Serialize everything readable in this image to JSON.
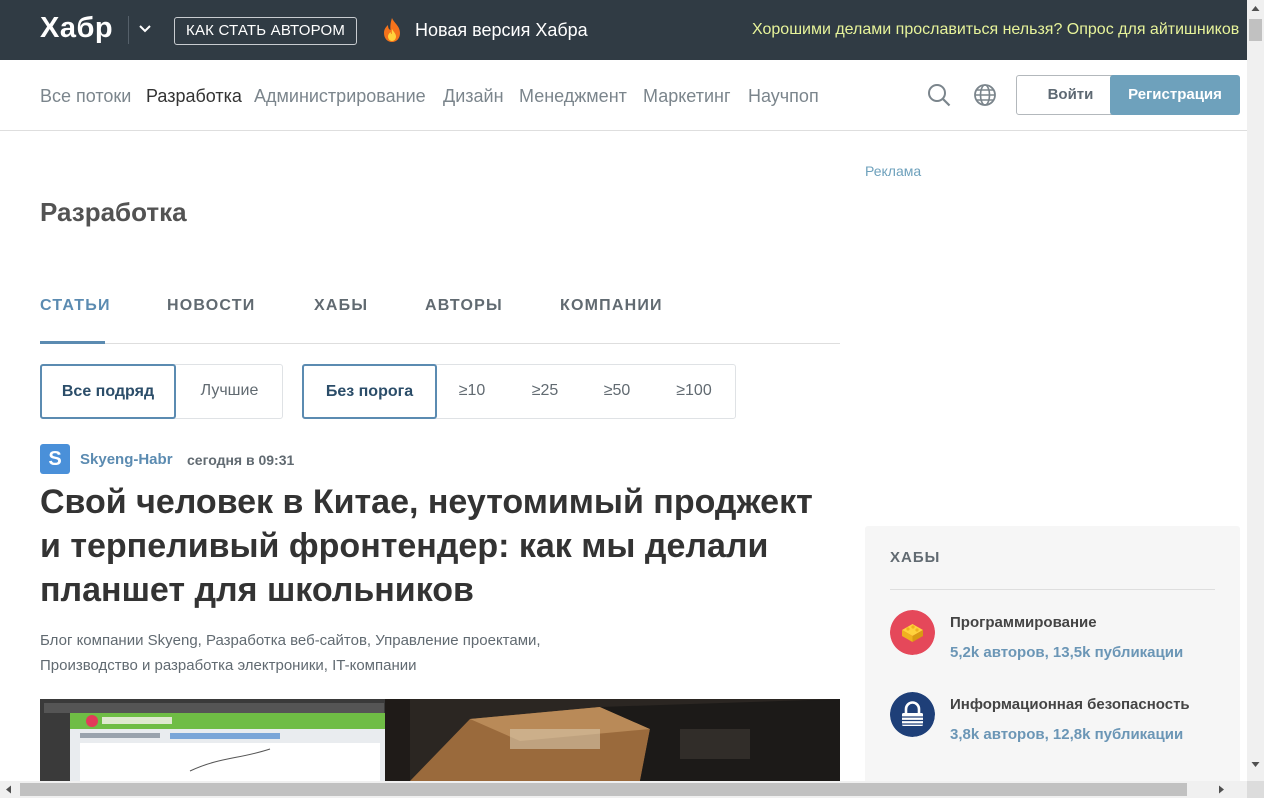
{
  "topbar": {
    "logo": "Хабр",
    "author_button": "КАК СТАТЬ АВТОРОМ",
    "new_version": "Новая версия Хабра",
    "promo": "Хорошими делами прославиться нельзя? Опрос для айтишников"
  },
  "nav": {
    "items": [
      "Все потоки",
      "Разработка",
      "Администрирование",
      "Дизайн",
      "Менеджмент",
      "Маркетинг",
      "Научпоп"
    ],
    "active": "Разработка",
    "login": "Войти",
    "signup": "Регистрация"
  },
  "main": {
    "title": "Разработка",
    "tabs": [
      "СТАТЬИ",
      "НОВОСТИ",
      "ХАБЫ",
      "АВТОРЫ",
      "КОМПАНИИ"
    ],
    "active_tab": "СТАТЬИ",
    "sort_filters": [
      "Все подряд",
      "Лучшие"
    ],
    "threshold_filters": [
      "Без порога",
      "≥10",
      "≥25",
      "≥50",
      "≥100"
    ]
  },
  "post": {
    "avatar_letter": "S",
    "author": "Skyeng-Habr",
    "time": "сегодня в 09:31",
    "title": "Свой человек в Китае, неутомимый проджект и терпеливый фронтендер: как мы делали планшет для школьников",
    "hubs_line1": "Блог компании Skyeng,  Разработка веб-сайтов,  Управление проектами,",
    "hubs_line2": "Производство и разработка электроники,  IT-компании"
  },
  "sidebar": {
    "ad_label": "Реклама",
    "hubs_title": "ХАБЫ",
    "hubs": [
      {
        "name": "Программирование",
        "stats": "5,2k авторов, 13,5k публикации",
        "color": "#e5485a"
      },
      {
        "name": "Информационная безопасность",
        "stats": "3,8k авторов, 12,8k публикации",
        "color": "#1e3f78"
      }
    ]
  },
  "colors": {
    "topbar": "#303b44",
    "accent": "#5b8bb1",
    "signup": "#6ea1bc",
    "promo": "#e7f39a"
  }
}
